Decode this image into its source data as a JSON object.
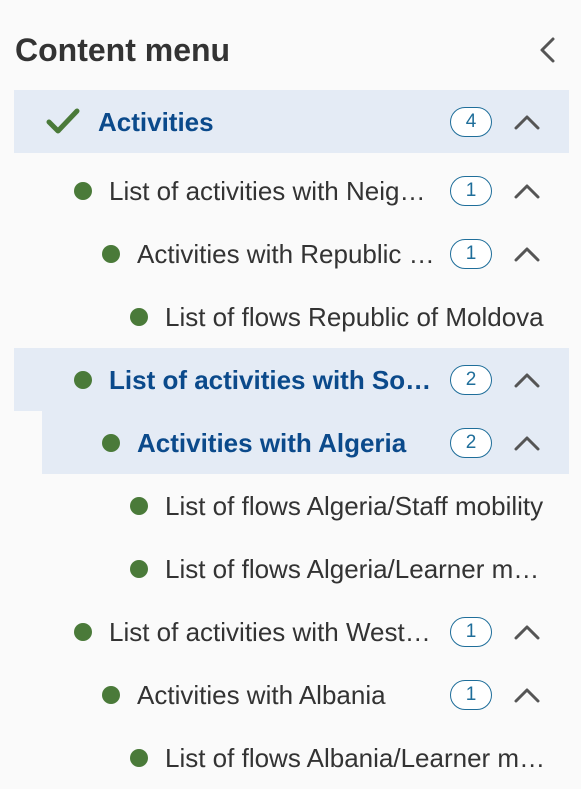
{
  "panel": {
    "title": "Content menu"
  },
  "menu": {
    "items": [
      {
        "label": "Activities",
        "count": "4",
        "level": 0,
        "active": true,
        "marker": "check-icon"
      },
      {
        "label": "List of activities with Neighbouring countries",
        "count": "1",
        "level": 1,
        "active": false,
        "marker": "bullet"
      },
      {
        "label": "Activities with Republic of Moldova",
        "count": "1",
        "level": 2,
        "active": false,
        "marker": "bullet"
      },
      {
        "label": "List of flows Republic of Moldova",
        "count": "",
        "level": 3,
        "active": false,
        "marker": "bullet"
      },
      {
        "label": "List of activities with Southern Mediterranean countries",
        "count": "2",
        "level": 1,
        "active": true,
        "marker": "bullet"
      },
      {
        "label": "Activities with Algeria",
        "count": "2",
        "level": 2,
        "active": true,
        "marker": "bullet"
      },
      {
        "label": "List of flows Algeria/Staff mobility",
        "count": "",
        "level": 3,
        "active": false,
        "marker": "bullet"
      },
      {
        "label": "List of flows Algeria/Learner mobility",
        "count": "",
        "level": 3,
        "active": false,
        "marker": "bullet"
      },
      {
        "label": "List of activities with Western Balkans",
        "count": "1",
        "level": 1,
        "active": false,
        "marker": "bullet"
      },
      {
        "label": "Activities with Albania",
        "count": "1",
        "level": 2,
        "active": false,
        "marker": "bullet"
      },
      {
        "label": "List of flows Albania/Learner mobility",
        "count": "",
        "level": 3,
        "active": false,
        "marker": "bullet"
      }
    ]
  },
  "colors": {
    "active_bg": "#e4ebf5",
    "active_text": "#0b4a8b",
    "bullet": "#4a7a39",
    "badge": "#1f6e9a"
  }
}
